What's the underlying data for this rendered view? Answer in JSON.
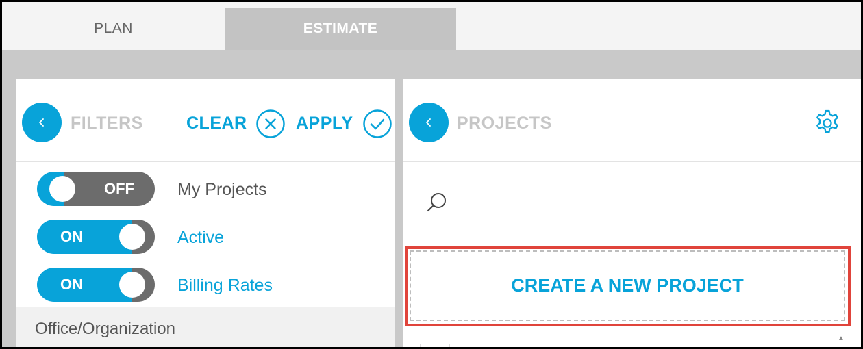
{
  "tabs": [
    {
      "label": "PLAN",
      "active": false
    },
    {
      "label": "ESTIMATE",
      "active": true
    }
  ],
  "filters": {
    "title": "FILTERS",
    "clear_label": "CLEAR",
    "apply_label": "APPLY",
    "toggles": [
      {
        "label": "My Projects",
        "state": "OFF"
      },
      {
        "label": "Active",
        "state": "ON"
      },
      {
        "label": "Billing Rates",
        "state": "ON"
      }
    ],
    "section_label": "Office/Organization"
  },
  "projects": {
    "title": "PROJECTS",
    "create_label": "CREATE A NEW PROJECT"
  },
  "colors": {
    "accent": "#08a3d9",
    "highlight": "#e0443b",
    "toggle_off": "#6c6c6c"
  }
}
